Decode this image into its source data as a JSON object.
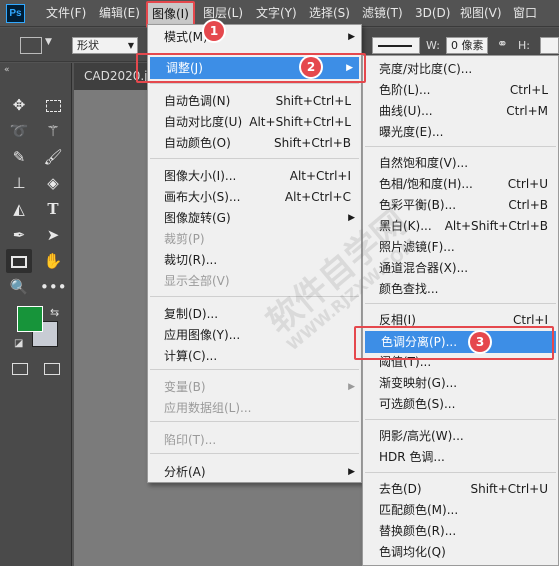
{
  "app": {
    "logo": "Ps"
  },
  "menubar": {
    "items": [
      "文件(F)",
      "编辑(E)",
      "图像(I)",
      "图层(L)",
      "文字(Y)",
      "选择(S)",
      "滤镜(T)",
      "3D(D)",
      "视图(V)",
      "窗口"
    ]
  },
  "options": {
    "shape_mode": "形状",
    "width_label": "W:",
    "width_value": "0 像素",
    "link_icon": "link-icon",
    "height_label": "H:"
  },
  "document": {
    "tab_title": "CAD2020.jp"
  },
  "image_menu": {
    "items": [
      {
        "label": "模式(M)",
        "shortcut": "",
        "arrow": true,
        "disabled": false
      },
      {
        "label": "调整(J)",
        "shortcut": "",
        "arrow": true,
        "disabled": false
      },
      {
        "label": "自动色调(N)",
        "shortcut": "Shift+Ctrl+L",
        "arrow": false,
        "disabled": false
      },
      {
        "label": "自动对比度(U)",
        "shortcut": "Alt+Shift+Ctrl+L",
        "arrow": false,
        "disabled": false
      },
      {
        "label": "自动颜色(O)",
        "shortcut": "Shift+Ctrl+B",
        "arrow": false,
        "disabled": false
      },
      {
        "label": "图像大小(I)...",
        "shortcut": "Alt+Ctrl+I",
        "arrow": false,
        "disabled": false
      },
      {
        "label": "画布大小(S)...",
        "shortcut": "Alt+Ctrl+C",
        "arrow": false,
        "disabled": false
      },
      {
        "label": "图像旋转(G)",
        "shortcut": "",
        "arrow": true,
        "disabled": false
      },
      {
        "label": "裁剪(P)",
        "shortcut": "",
        "arrow": false,
        "disabled": true
      },
      {
        "label": "裁切(R)...",
        "shortcut": "",
        "arrow": false,
        "disabled": false
      },
      {
        "label": "显示全部(V)",
        "shortcut": "",
        "arrow": false,
        "disabled": true
      },
      {
        "label": "复制(D)...",
        "shortcut": "",
        "arrow": false,
        "disabled": false
      },
      {
        "label": "应用图像(Y)...",
        "shortcut": "",
        "arrow": false,
        "disabled": false
      },
      {
        "label": "计算(C)...",
        "shortcut": "",
        "arrow": false,
        "disabled": false
      },
      {
        "label": "变量(B)",
        "shortcut": "",
        "arrow": true,
        "disabled": true
      },
      {
        "label": "应用数据组(L)...",
        "shortcut": "",
        "arrow": false,
        "disabled": true
      },
      {
        "label": "陷印(T)...",
        "shortcut": "",
        "arrow": false,
        "disabled": true
      },
      {
        "label": "分析(A)",
        "shortcut": "",
        "arrow": true,
        "disabled": false
      }
    ]
  },
  "adjust_menu": {
    "items": [
      {
        "label": "亮度/对比度(C)...",
        "shortcut": ""
      },
      {
        "label": "色阶(L)...",
        "shortcut": "Ctrl+L"
      },
      {
        "label": "曲线(U)...",
        "shortcut": "Ctrl+M"
      },
      {
        "label": "曝光度(E)...",
        "shortcut": ""
      },
      {
        "label": "自然饱和度(V)...",
        "shortcut": ""
      },
      {
        "label": "色相/饱和度(H)...",
        "shortcut": "Ctrl+U"
      },
      {
        "label": "色彩平衡(B)...",
        "shortcut": "Ctrl+B"
      },
      {
        "label": "黑白(K)...",
        "shortcut": "Alt+Shift+Ctrl+B"
      },
      {
        "label": "照片滤镜(F)...",
        "shortcut": ""
      },
      {
        "label": "通道混合器(X)...",
        "shortcut": ""
      },
      {
        "label": "颜色查找...",
        "shortcut": ""
      },
      {
        "label": "反相(I)",
        "shortcut": "Ctrl+I"
      },
      {
        "label": "色调分离(P)...",
        "shortcut": ""
      },
      {
        "label": "阈值(T)...",
        "shortcut": ""
      },
      {
        "label": "渐变映射(G)...",
        "shortcut": ""
      },
      {
        "label": "可选颜色(S)...",
        "shortcut": ""
      },
      {
        "label": "阴影/高光(W)...",
        "shortcut": ""
      },
      {
        "label": "HDR 色调...",
        "shortcut": ""
      },
      {
        "label": "去色(D)",
        "shortcut": "Shift+Ctrl+U"
      },
      {
        "label": "匹配颜色(M)...",
        "shortcut": ""
      },
      {
        "label": "替换颜色(R)...",
        "shortcut": ""
      },
      {
        "label": "色调均化(Q)",
        "shortcut": ""
      }
    ]
  },
  "badges": [
    "1",
    "2",
    "3"
  ],
  "watermark": {
    "text": "软件自学网",
    "subtext": "WWW.RJZXW.COM"
  },
  "colors": {
    "foreground": "#17943a",
    "background": "#c8ccd4",
    "highlight": "#3d8ee6",
    "annotation": "#e5484d"
  }
}
